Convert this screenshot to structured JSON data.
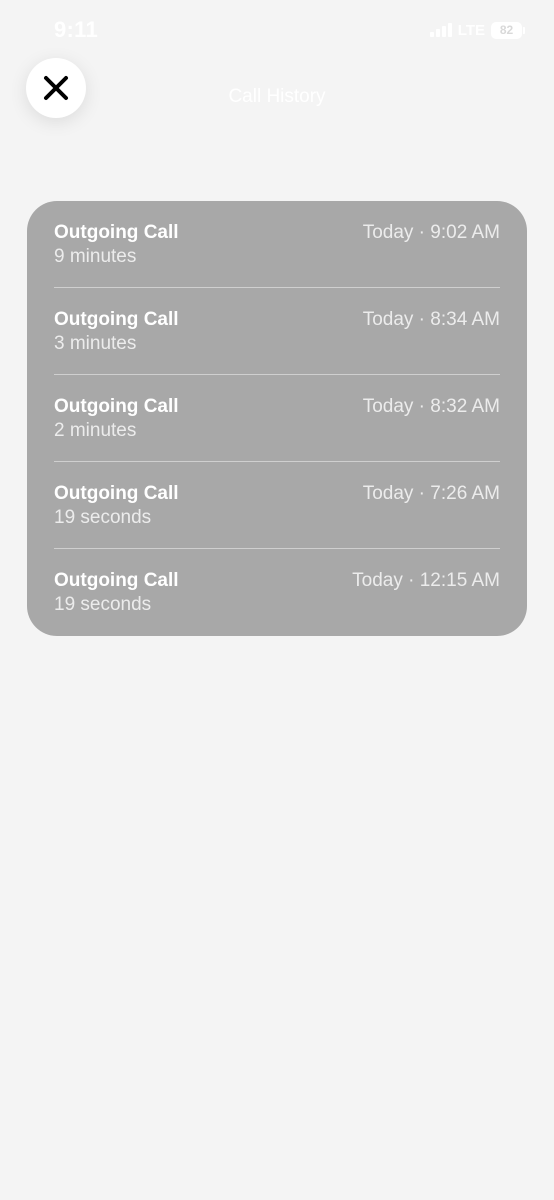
{
  "status_bar": {
    "time": "9:11",
    "network": "LTE",
    "battery": "82"
  },
  "header": {
    "title": "Call History"
  },
  "calls": [
    {
      "type": "Outgoing Call",
      "duration": "9 minutes",
      "time": "Today · 9:02 AM"
    },
    {
      "type": "Outgoing Call",
      "duration": "3 minutes",
      "time": "Today · 8:34 AM"
    },
    {
      "type": "Outgoing Call",
      "duration": "2 minutes",
      "time": "Today · 8:32 AM"
    },
    {
      "type": "Outgoing Call",
      "duration": "19 seconds",
      "time": "Today · 7:26 AM"
    },
    {
      "type": "Outgoing Call",
      "duration": "19 seconds",
      "time": "Today · 12:15 AM"
    }
  ],
  "icons": {
    "close": "close-icon",
    "signal": "signal-icon",
    "battery": "battery-icon"
  },
  "colors": {
    "background": "#f4f4f4",
    "card": "#a8a8a8",
    "text_primary": "#ffffff"
  }
}
